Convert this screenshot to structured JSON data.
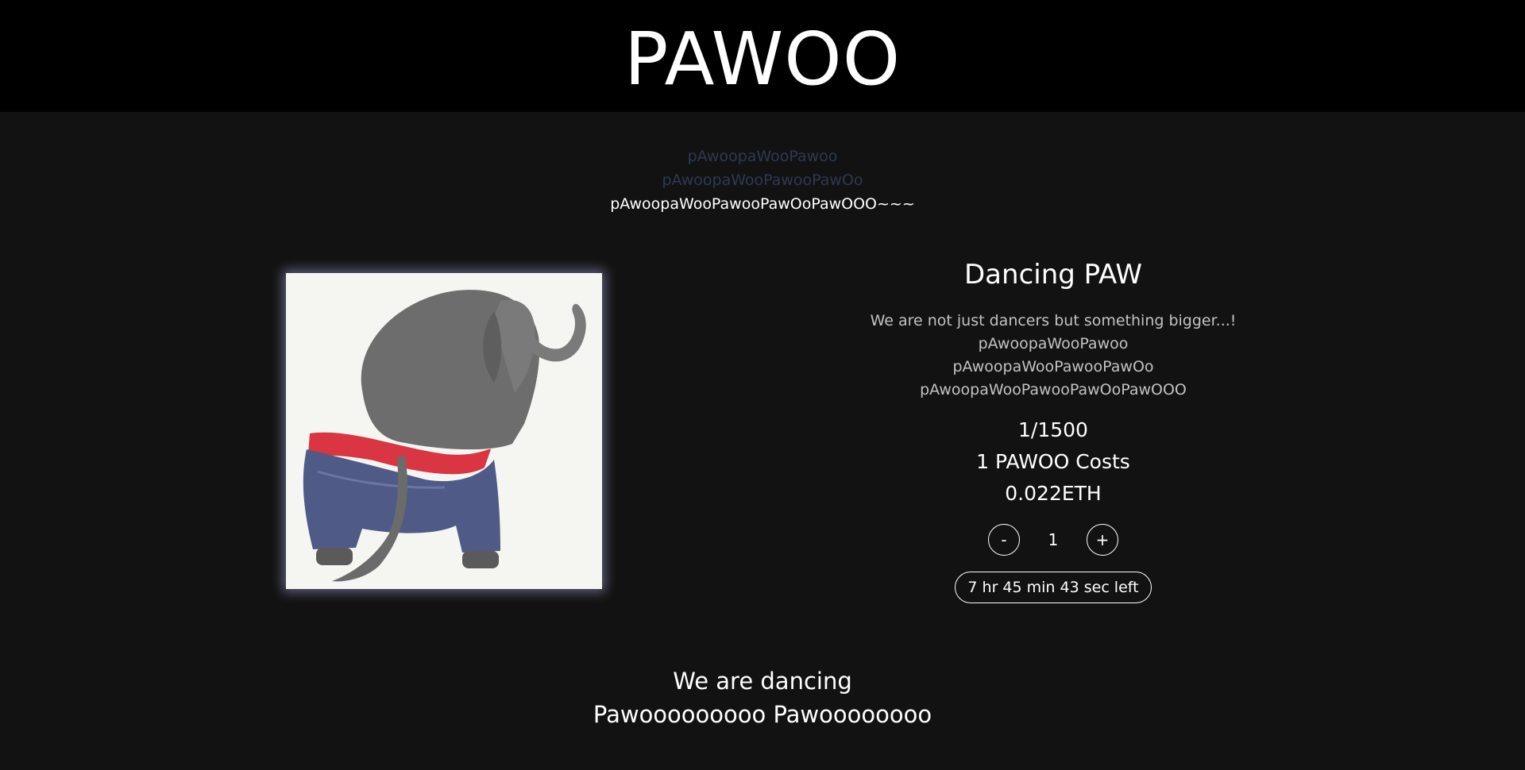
{
  "header": {
    "brand": "PAWOO"
  },
  "chant": {
    "line1": "pAwoopaWooPawoo",
    "line2": "pAwoopaWooPawooPawOo",
    "line3": "pAwoopaWooPawooPawOoPawOOO~~~"
  },
  "mint": {
    "title": "Dancing PAW",
    "description": [
      "We are not just dancers but something bigger...!",
      "pAwoopaWooPawoo",
      "pAwoopaWooPawooPawOo",
      "pAwoopaWooPawooPawOoPawOOO"
    ],
    "supply": "1/1500",
    "cost_label": "1 PAWOO Costs",
    "price": "0.022ETH",
    "decrement_label": "-",
    "quantity": "1",
    "increment_label": "+",
    "countdown": "7 hr 45 min 43 sec left"
  },
  "footer": {
    "line1": "We are dancing",
    "line2": "Pawooooooooo Pawoooooooo"
  },
  "icons": {
    "artwork": "elephant-in-jeans-image"
  },
  "colors": {
    "header_bg": "#000000",
    "page_bg": "#121212",
    "chant_dim": "#2c3a52",
    "text": "#ffffff",
    "desc_text": "#c2c2c2",
    "art_glow": "#bebeff"
  }
}
